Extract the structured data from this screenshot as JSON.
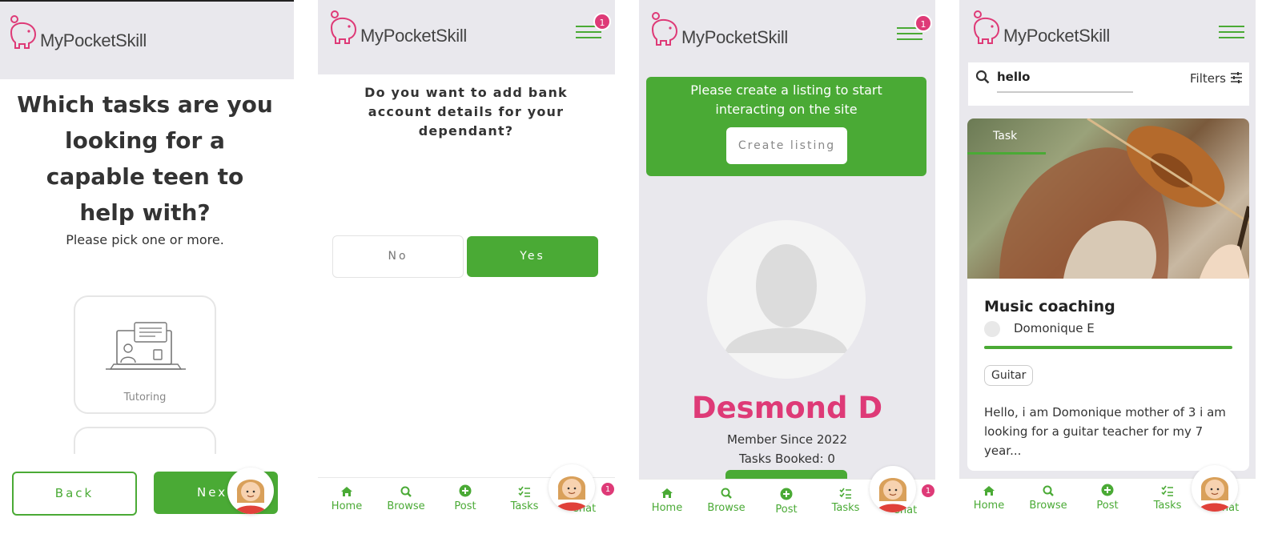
{
  "brand": {
    "name": "MyPocketSkill",
    "accent": "#4aaa35",
    "pink": "#de3a77"
  },
  "screen1": {
    "question": "Which tasks are you looking for a capable teen to help with?",
    "hint": "Please pick one or more.",
    "option_label": "Tutoring",
    "back_label": "Back",
    "next_label": "Next"
  },
  "screen2": {
    "badge": "1",
    "question": "Do you want to add bank account details for your dependant?",
    "no_label": "No",
    "yes_label": "Yes",
    "chat_badge": "1"
  },
  "screen3": {
    "badge": "1",
    "banner_text": "Please create a listing to start interacting on the site",
    "create_listing_label": "Create listing",
    "name": "Desmond D",
    "member_since": "Member Since 2022",
    "tasks_booked_label": "Tasks Booked:",
    "tasks_booked_value": "0",
    "chat_badge": "1"
  },
  "screen4": {
    "search_value": "hello",
    "filters_label": "Filters",
    "card_tag": "Task",
    "card_title": "Music coaching",
    "card_author": "Domonique E",
    "card_skill": "Guitar",
    "card_desc": "Hello, i am Domonique mother of 3 i am looking for a guitar teacher for my 7 year..."
  },
  "nav": {
    "home": "Home",
    "browse": "Browse",
    "post": "Post",
    "tasks": "Tasks",
    "chat": "Chat"
  }
}
